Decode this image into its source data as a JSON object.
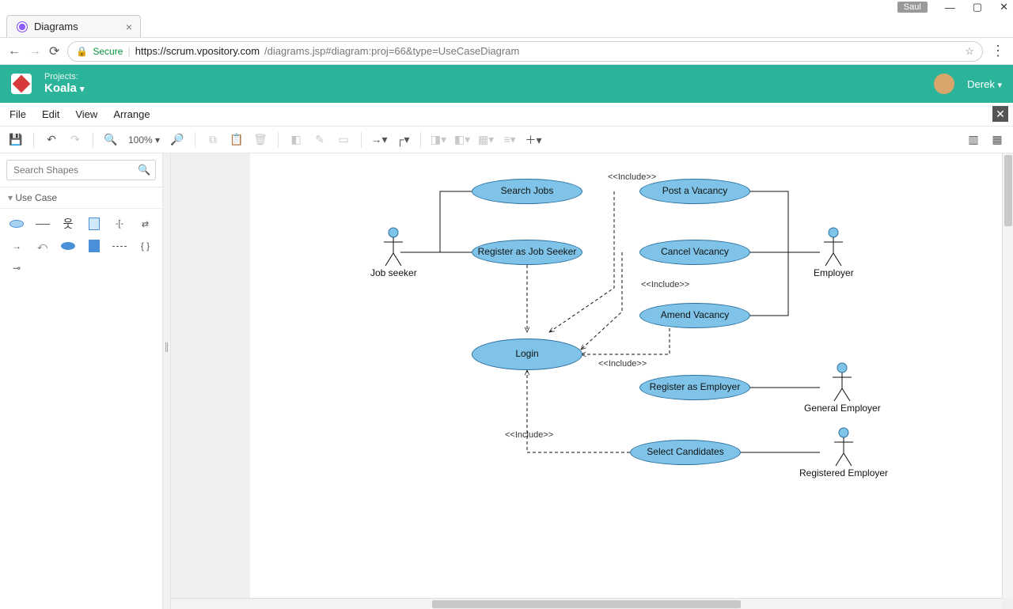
{
  "os": {
    "user": "Saul"
  },
  "browser": {
    "tab_title": "Diagrams",
    "secure_label": "Secure",
    "url_host": "https://scrum.vpository.com",
    "url_path": "/diagrams.jsp#diagram:proj=66&type=UseCaseDiagram"
  },
  "app": {
    "projects_label": "Projects:",
    "project_name": "Koala",
    "user_name": "Derek"
  },
  "menu": {
    "file": "File",
    "edit": "Edit",
    "view": "View",
    "arrange": "Arrange"
  },
  "toolbar": {
    "zoom": "100%"
  },
  "sidebar": {
    "search_placeholder": "Search Shapes",
    "panel_title": "Use Case"
  },
  "diagram": {
    "actors": {
      "job_seeker": "Job seeker",
      "employer": "Employer",
      "general_employer": "General Employer",
      "registered_employer": "Registered Employer"
    },
    "usecases": {
      "search_jobs": "Search Jobs",
      "register_seeker": "Register as Job Seeker",
      "post_vacancy": "Post a Vacancy",
      "cancel_vacancy": "Cancel Vacancy",
      "amend_vacancy": "Amend Vacancy",
      "login": "Login",
      "register_employer": "Register as Employer",
      "select_candidates": "Select Candidates"
    },
    "include_label": "<<Include>>"
  },
  "chart_data": {
    "type": "uml-use-case",
    "actors": [
      {
        "id": "job_seeker",
        "name": "Job seeker"
      },
      {
        "id": "employer",
        "name": "Employer"
      },
      {
        "id": "general_employer",
        "name": "General Employer"
      },
      {
        "id": "registered_employer",
        "name": "Registered Employer"
      }
    ],
    "use_cases": [
      {
        "id": "search_jobs",
        "name": "Search Jobs"
      },
      {
        "id": "register_seeker",
        "name": "Register as Job Seeker"
      },
      {
        "id": "post_vacancy",
        "name": "Post a Vacancy"
      },
      {
        "id": "cancel_vacancy",
        "name": "Cancel Vacancy"
      },
      {
        "id": "amend_vacancy",
        "name": "Amend Vacancy"
      },
      {
        "id": "login",
        "name": "Login"
      },
      {
        "id": "register_employer",
        "name": "Register as Employer"
      },
      {
        "id": "select_candidates",
        "name": "Select Candidates"
      }
    ],
    "associations": [
      {
        "actor": "job_seeker",
        "use_case": "search_jobs"
      },
      {
        "actor": "job_seeker",
        "use_case": "register_seeker"
      },
      {
        "actor": "employer",
        "use_case": "post_vacancy"
      },
      {
        "actor": "employer",
        "use_case": "cancel_vacancy"
      },
      {
        "actor": "employer",
        "use_case": "amend_vacancy"
      },
      {
        "actor": "general_employer",
        "use_case": "register_employer"
      },
      {
        "actor": "registered_employer",
        "use_case": "select_candidates"
      }
    ],
    "includes": [
      {
        "from": "register_seeker",
        "to": "login"
      },
      {
        "from": "post_vacancy",
        "to": "login"
      },
      {
        "from": "cancel_vacancy",
        "to": "login"
      },
      {
        "from": "amend_vacancy",
        "to": "login"
      },
      {
        "from": "select_candidates",
        "to": "login"
      }
    ]
  }
}
